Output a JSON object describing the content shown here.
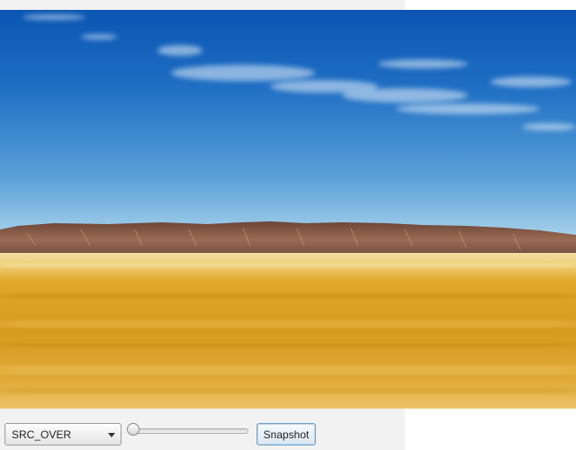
{
  "controls": {
    "blend_mode": {
      "selected": "SRC_OVER"
    },
    "opacity_slider": {
      "value": 0
    },
    "snapshot_button": {
      "label": "Snapshot"
    }
  },
  "scene": {
    "description_icon": "landscape-image",
    "colors": {
      "sky_top": "#0a59b6",
      "sky_horizon": "#8ec3e6",
      "mesa": "#7a4d3a",
      "desert": "#dca62a"
    }
  }
}
